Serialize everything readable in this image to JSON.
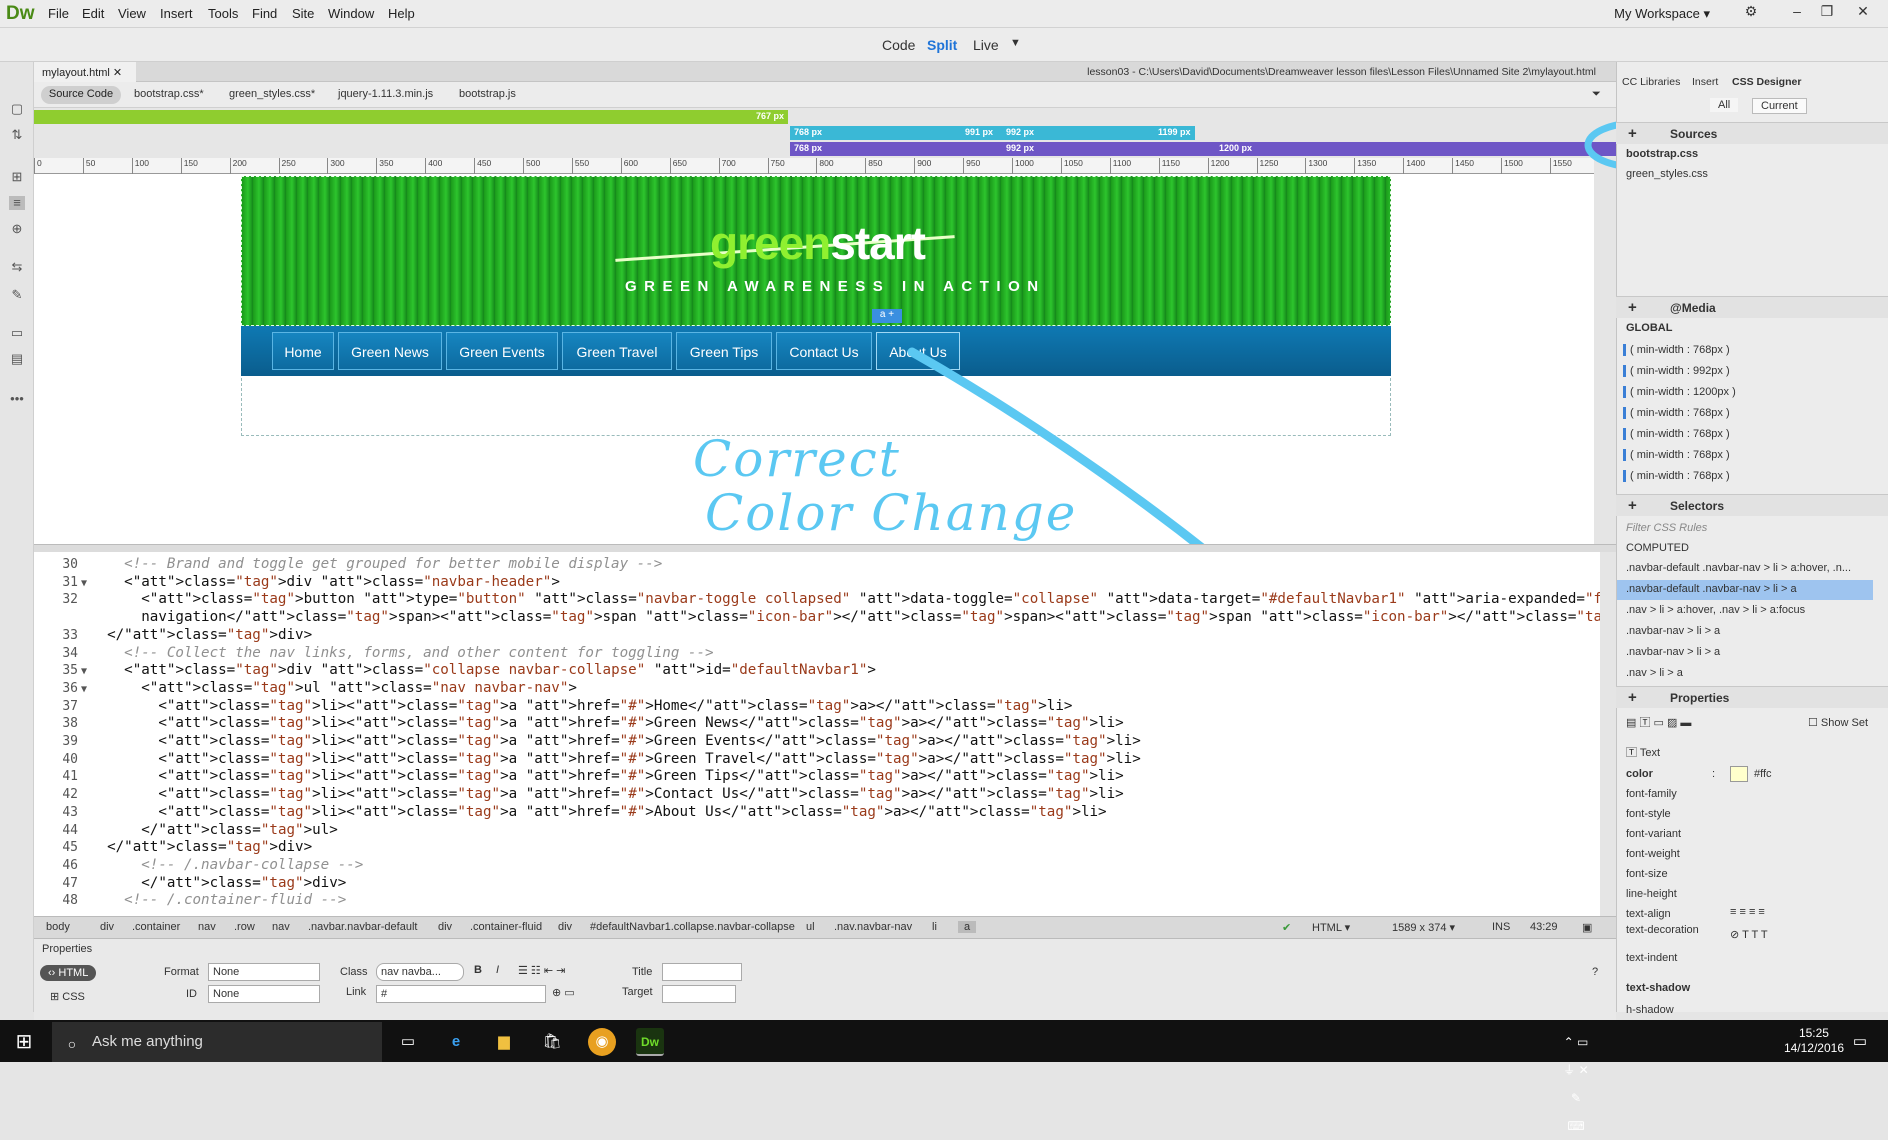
{
  "app": {
    "logo": "Dw",
    "workspace": "My Workspace"
  },
  "menu": [
    "File",
    "Edit",
    "View",
    "Insert",
    "Tools",
    "Find",
    "Site",
    "Window",
    "Help"
  ],
  "view_modes": {
    "code": "Code",
    "split": "Split",
    "live": "Live"
  },
  "document": {
    "tab": "mylayout.html",
    "path": "lesson03 - C:\\Users\\David\\Documents\\Dreamweaver lesson files\\Lesson Files\\Unnamed Site 2\\mylayout.html",
    "related_files": [
      "Source Code",
      "bootstrap.css*",
      "green_styles.css*",
      "jquery-1.11.3.min.js",
      "bootstrap.js"
    ]
  },
  "media_queries": {
    "bar1": "767 px",
    "bar2a": "768 px",
    "bar2b": "991 px",
    "bar2c": "992 px",
    "bar2d": "1199 px",
    "bar3a": "768 px",
    "bar3b": "992 px",
    "bar3c": "1200 px"
  },
  "ruler": [
    "0",
    "50",
    "100",
    "150",
    "200",
    "250",
    "300",
    "350",
    "400",
    "450",
    "500",
    "550",
    "600",
    "650",
    "700",
    "750",
    "800",
    "850",
    "900",
    "950",
    "1000",
    "1050",
    "1100",
    "1150",
    "1200",
    "1250",
    "1300",
    "1350",
    "1400",
    "1450",
    "1500",
    "1550"
  ],
  "site": {
    "brand_green": "green",
    "brand_start": "start",
    "tagline": "GREEN AWARENESS IN ACTION",
    "nav": [
      "Home",
      "Green News",
      "Green Events",
      "Green Travel",
      "Green Tips",
      "Contact Us",
      "About Us"
    ],
    "nav_selector": "a"
  },
  "annotation": {
    "line1": "Correct",
    "line2": "Color Change",
    "color": "#5bc8f2"
  },
  "code_lines": [
    {
      "n": "30",
      "t": "    <!-- Brand and toggle get grouped for better mobile display -->"
    },
    {
      "n": "31",
      "t": "    <div class=\"navbar-header\">"
    },
    {
      "n": "32",
      "t": "      <button type=\"button\" class=\"navbar-toggle collapsed\" data-toggle=\"collapse\" data-target=\"#defaultNavbar1\" aria-expanded=\"false\"><span class=\"sr-only\">Toggle"
    },
    {
      "n": "",
      "t": "      navigation</span><span class=\"icon-bar\"></span><span class=\"icon-bar\"></span><span class=\"icon-bar\"></span></button>"
    },
    {
      "n": "33",
      "t": "  </div>"
    },
    {
      "n": "34",
      "t": "    <!-- Collect the nav links, forms, and other content for toggling -->"
    },
    {
      "n": "35",
      "t": "    <div class=\"collapse navbar-collapse\" id=\"defaultNavbar1\">"
    },
    {
      "n": "36",
      "t": "      <ul class=\"nav navbar-nav\">"
    },
    {
      "n": "37",
      "t": "        <li><a href=\"#\">Home</a></li>"
    },
    {
      "n": "38",
      "t": "        <li><a href=\"#\">Green News</a></li>"
    },
    {
      "n": "39",
      "t": "        <li><a href=\"#\">Green Events</a></li>"
    },
    {
      "n": "40",
      "t": "        <li><a href=\"#\">Green Travel</a></li>"
    },
    {
      "n": "41",
      "t": "        <li><a href=\"#\">Green Tips</a></li>"
    },
    {
      "n": "42",
      "t": "        <li><a href=\"#\">Contact Us</a></li>"
    },
    {
      "n": "43",
      "t": "        <li><a href=\"#\">About Us</a></li>"
    },
    {
      "n": "44",
      "t": "      </ul>"
    },
    {
      "n": "45",
      "t": "  </div>"
    },
    {
      "n": "46",
      "t": "      <!-- /.navbar-collapse -->"
    },
    {
      "n": "47",
      "t": "      </div>"
    },
    {
      "n": "48",
      "t": "    <!-- /.container-fluid -->"
    }
  ],
  "tag_selector": [
    "body",
    "div",
    ".container",
    "nav",
    ".row",
    "nav",
    ".navbar.navbar-default",
    "div",
    ".container-fluid",
    "div",
    "#defaultNavbar1.collapse.navbar-collapse",
    "ul",
    ".nav.navbar-nav",
    "li",
    "a"
  ],
  "status": {
    "doctype": "HTML",
    "size": "1589 x 374",
    "mode": "INS",
    "pos": "43:29"
  },
  "properties": {
    "title": "Properties",
    "html": "HTML",
    "css": "CSS",
    "format_label": "Format",
    "format_value": "None",
    "id_label": "ID",
    "id_value": "None",
    "class_label": "Class",
    "class_value": "nav navba...",
    "link_label": "Link",
    "link_value": "#",
    "title_label": "Title",
    "target_label": "Target"
  },
  "right_panel": {
    "tabs": [
      "CC Libraries",
      "Insert",
      "CSS Designer"
    ],
    "toggle_all": "All",
    "toggle_current": "Current",
    "sources_title": "Sources",
    "sources": [
      "bootstrap.css",
      "green_styles.css"
    ],
    "media_title": "@Media",
    "media_global": "GLOBAL",
    "media": [
      "( min-width : 768px )",
      "( min-width : 992px )",
      "( min-width : 1200px )",
      "( min-width : 768px )",
      "( min-width : 768px )",
      "( min-width : 768px )",
      "( min-width : 768px )"
    ],
    "selectors_title": "Selectors",
    "filter_placeholder": "Filter CSS Rules",
    "computed": "COMPUTED",
    "selectors": [
      ".navbar-default .navbar-nav > li > a:hover, .n...",
      ".navbar-default .navbar-nav > li > a",
      ".nav > li > a:hover, .nav > li > a:focus",
      ".navbar-nav > li > a",
      ".navbar-nav > li > a",
      ".nav > li > a"
    ],
    "properties_title": "Properties",
    "show_set": "Show Set",
    "text_section": "Text",
    "color_label": "color",
    "color_value": "#ffc",
    "text_props": [
      "font-family",
      "font-style",
      "font-variant",
      "font-weight",
      "font-size",
      "line-height",
      "text-align",
      "text-decoration",
      "text-indent"
    ],
    "shadow_section": "text-shadow",
    "h_shadow": "h-shadow"
  },
  "taskbar": {
    "search": "Ask me anything",
    "time": "15:25",
    "date": "14/12/2016"
  }
}
